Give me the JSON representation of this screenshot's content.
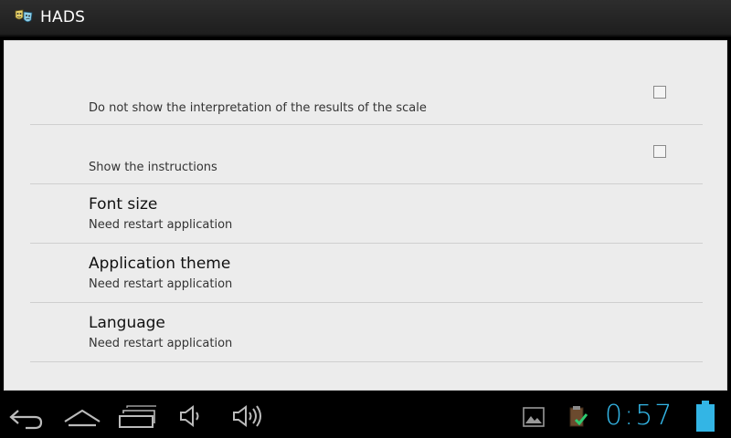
{
  "app": {
    "title": "HADS",
    "icon": "hads-masks-icon"
  },
  "preferences": [
    {
      "type": "checkbox",
      "summary": "Do not show the interpretation of the results of the scale",
      "checked": false
    },
    {
      "type": "checkbox",
      "summary": "Show the instructions",
      "checked": false
    },
    {
      "type": "list",
      "title": "Font size",
      "summary": "Need restart application"
    },
    {
      "type": "list",
      "title": "Application theme",
      "summary": "Need restart application"
    },
    {
      "type": "list",
      "title": "Language",
      "summary": "Need restart application"
    }
  ],
  "system_bar": {
    "nav_icons": [
      "back-icon",
      "home-icon",
      "recent-apps-icon",
      "volume-down-icon",
      "volume-up-icon"
    ],
    "status_icons": [
      "gallery-notification-icon",
      "download-complete-icon",
      "battery-icon"
    ],
    "time": "0:57",
    "clock_color": "#33b5e5"
  }
}
